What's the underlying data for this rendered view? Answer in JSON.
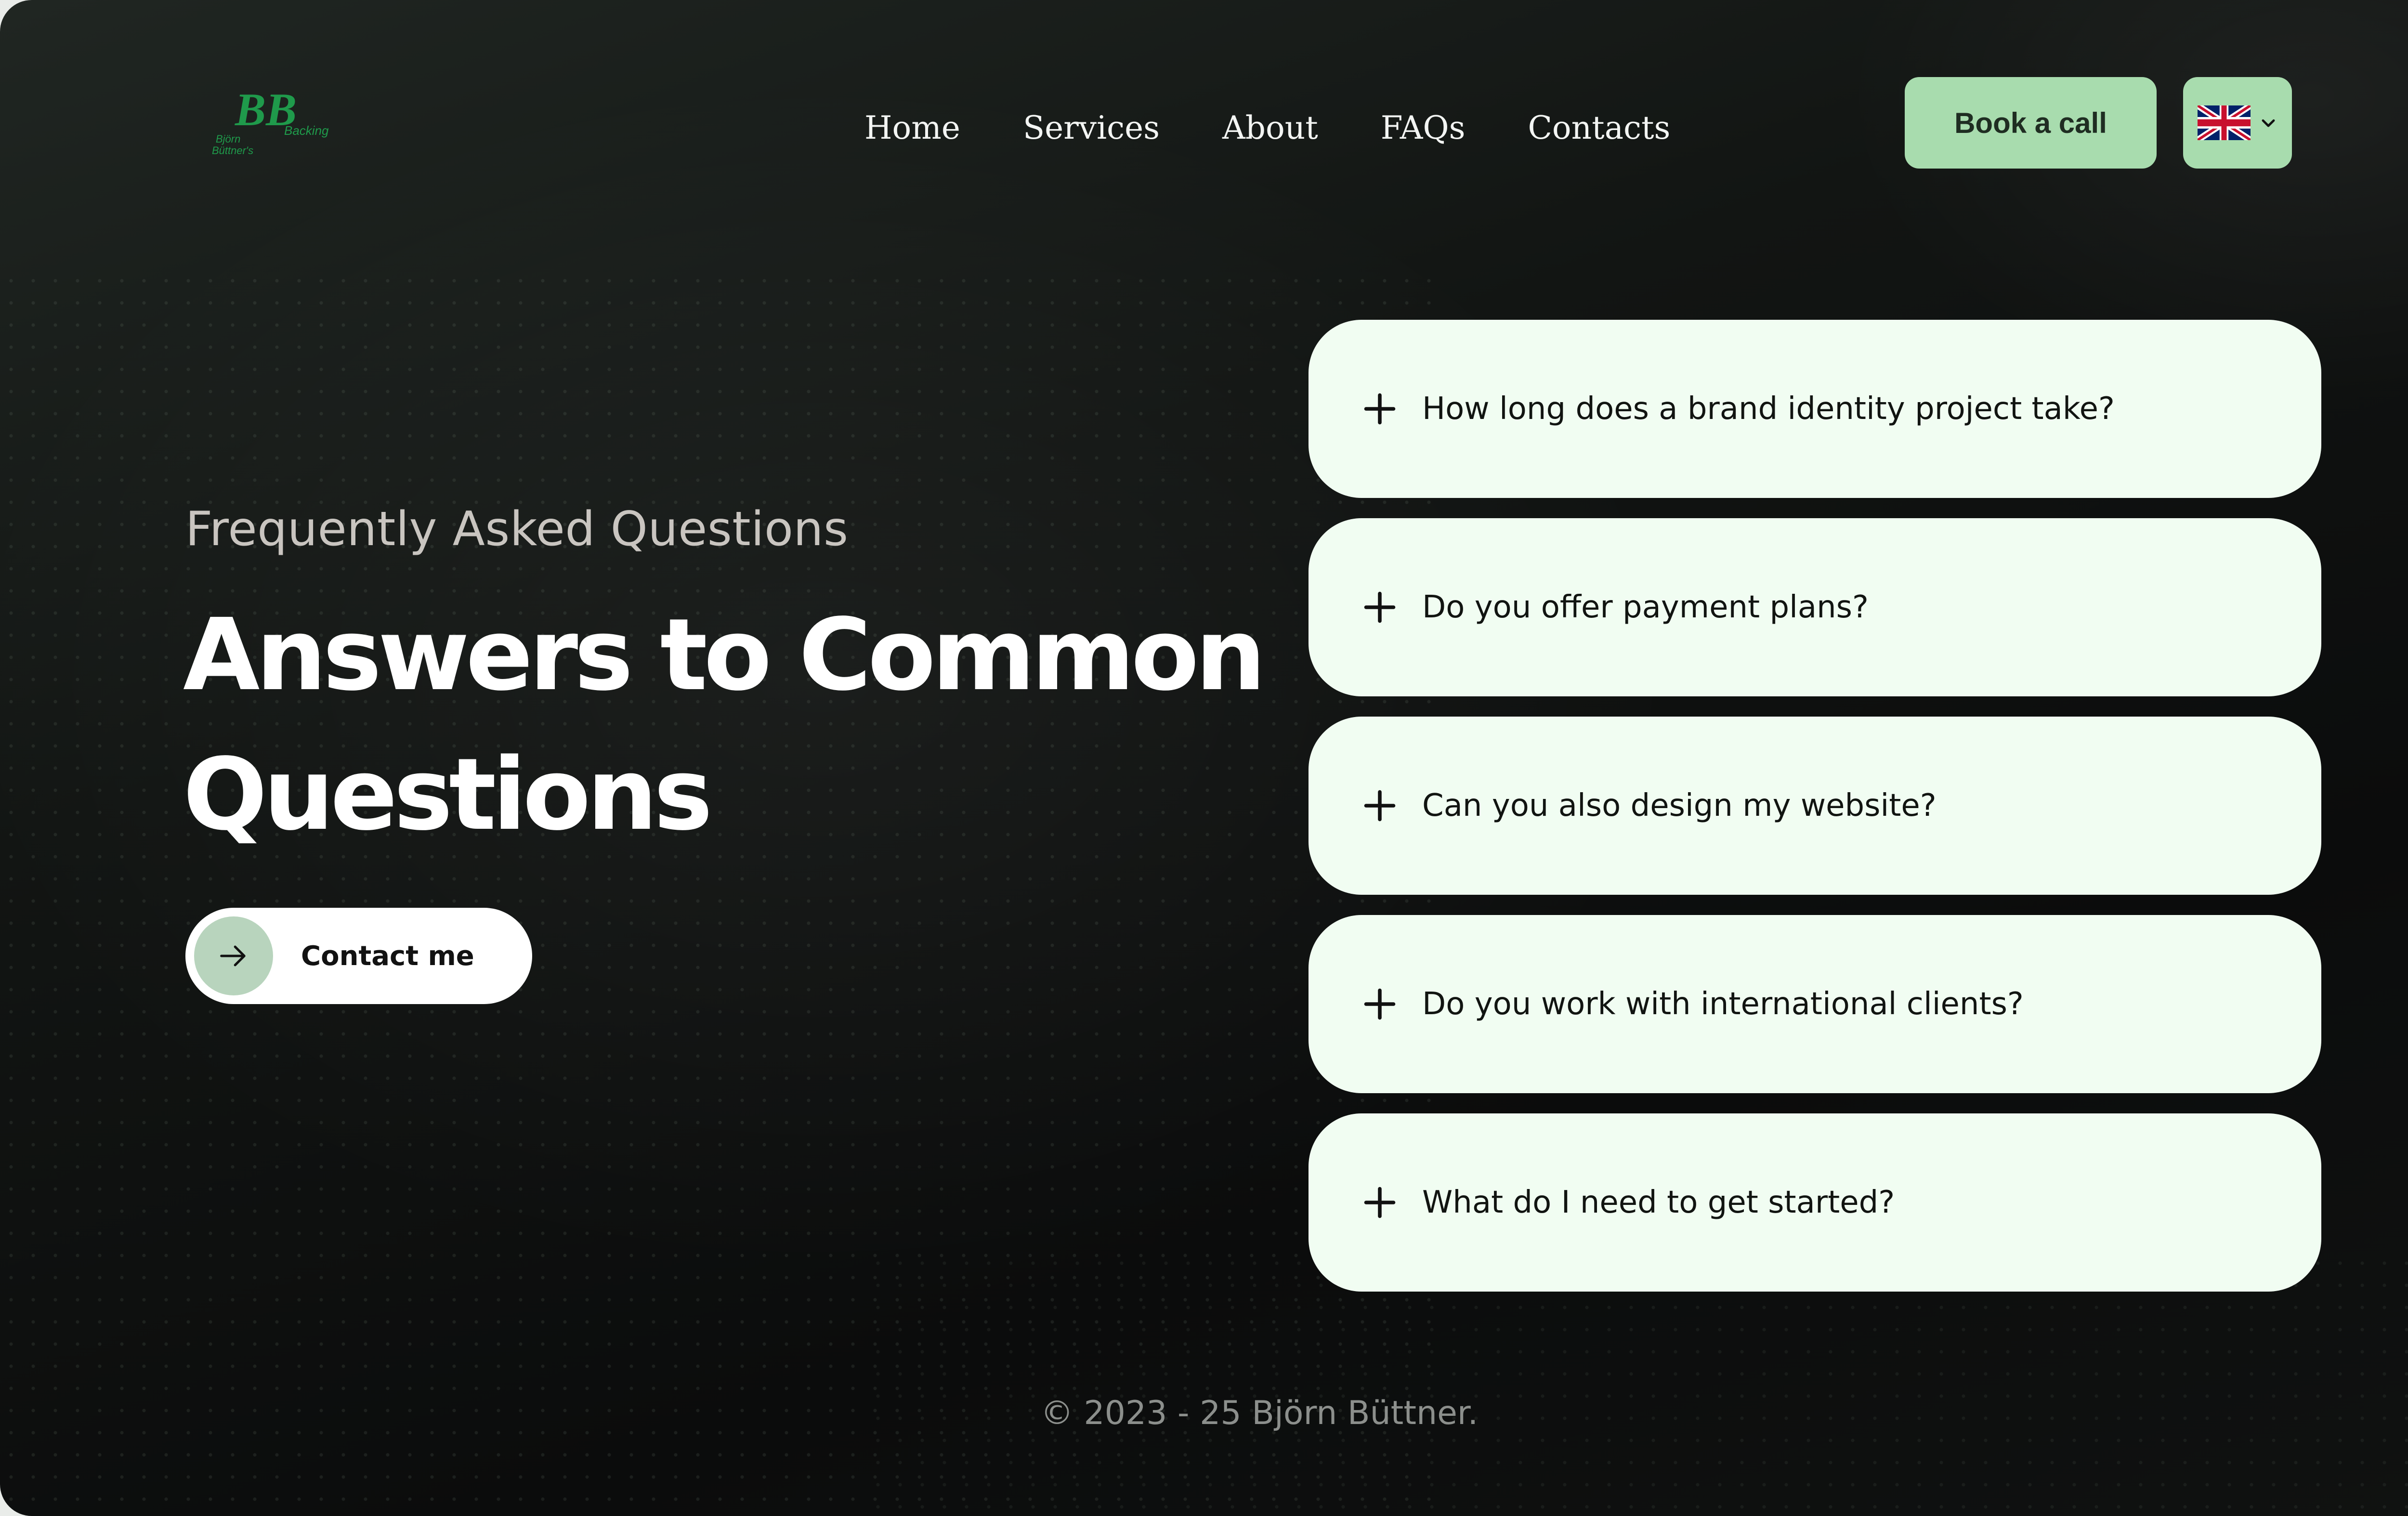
{
  "brand": {
    "logo_letters": "BB",
    "logo_text_top": "Björn",
    "logo_text_bottom": "Büttner's",
    "logo_text_side": "Backing",
    "logo_color": "#1f9a4b"
  },
  "nav": {
    "items": [
      "Home",
      "Services",
      "About",
      "FAQs",
      "Contacts"
    ]
  },
  "header": {
    "book_label": "Book a call",
    "language_icon": "uk-flag-icon",
    "accent_color": "#a8dcae"
  },
  "hero": {
    "eyebrow": "Frequently Asked Questions",
    "title_line1": "Answers to Common",
    "title_line2": "Questions",
    "contact_label": "Contact me",
    "contact_icon": "arrow-right-icon"
  },
  "faq": {
    "expand_icon": "plus-icon",
    "questions": [
      "How long does a brand identity project take?",
      "Do you offer payment plans?",
      "Can you also design my website?",
      "Do you work with international clients?",
      "What do I need to get started?"
    ]
  },
  "footer": {
    "copyright": "© 2023 - 25 Björn Büttner."
  }
}
